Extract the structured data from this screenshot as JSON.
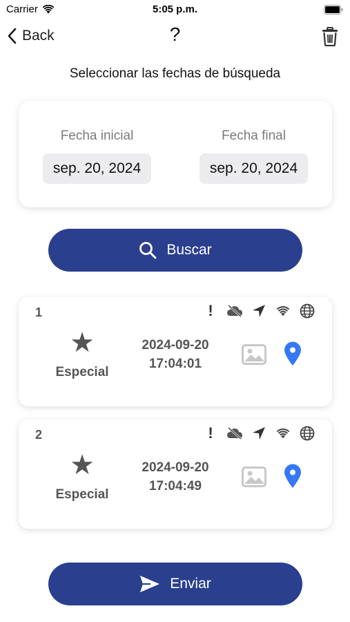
{
  "status_bar": {
    "carrier": "Carrier",
    "time": "5:05 p.m."
  },
  "nav": {
    "back_label": "Back",
    "help_label": "?"
  },
  "subtitle": "Seleccionar las fechas de búsqueda",
  "dates": {
    "start_label": "Fecha inicial",
    "start_value": "sep. 20, 2024",
    "end_label": "Fecha final",
    "end_value": "sep. 20, 2024"
  },
  "search_button": {
    "label": "Buscar",
    "icon": "search-icon"
  },
  "records": [
    {
      "number": "1",
      "type": "Especial",
      "date": "2024-09-20",
      "time": "17:04:01"
    },
    {
      "number": "2",
      "type": "Especial",
      "date": "2024-09-20",
      "time": "17:04:49"
    }
  ],
  "record_status_icons": [
    "alert-icon",
    "cloud-off-icon",
    "location-arrow-icon",
    "wifi-icon",
    "globe-icon"
  ],
  "send_button": {
    "label": "Enviar",
    "icon": "send-icon"
  },
  "colors": {
    "primary": "#2b3f8f",
    "pin": "#3478f6",
    "card_bg": "#ffffff",
    "pill_bg": "#ececef"
  }
}
